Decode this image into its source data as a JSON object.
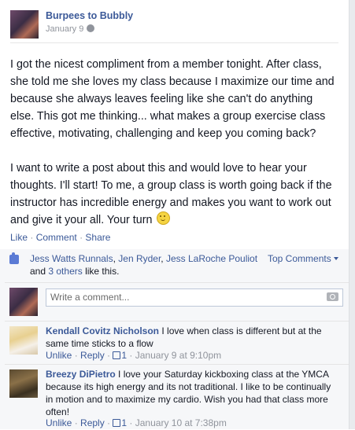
{
  "post": {
    "author": "Burpees to Bubbly",
    "date": "January 9",
    "paragraph1": "I got the nicest compliment from a member tonight. After class, she told me she loves my class because I maximize our time and because she always leaves feeling like she can't do anything else. This got me thinking... what makes a group exercise class effective, motivating, challenging and keep you coming back?",
    "paragraph2": "I want to write a post about this and would love to hear your thoughts. I'll start! To me, a group class is worth going back if the instructor has incredible energy and makes you want to work out and give it your all. Your turn",
    "actions": {
      "like": "Like",
      "comment": "Comment",
      "share": "Share",
      "sep": "·"
    }
  },
  "likes": {
    "names": [
      "Jess Watts Runnals",
      "Jen Ryder",
      "Jess LaRoche Pouliot"
    ],
    "and": "and",
    "others": "3 others",
    "suffix": "like this.",
    "top_comments": "Top Comments"
  },
  "write_comment": {
    "placeholder": "Write a comment..."
  },
  "comments": [
    {
      "name": "Kendall Covitz Nicholson",
      "text": "I love when class is different but at the same time sticks to a flow",
      "unlike": "Unlike",
      "reply": "Reply",
      "likes": "1",
      "date": "January 9 at 9:10pm"
    },
    {
      "name": "Breezy DiPietro",
      "text": "I love your Saturday kickboxing class at the YMCA because its high energy and its not traditional. I like to be continually in motion and to maximize my cardio. Wish you had that class more often!",
      "unlike": "Unlike",
      "reply": "Reply",
      "likes": "1",
      "date": "January 10 at 7:38pm"
    }
  ]
}
